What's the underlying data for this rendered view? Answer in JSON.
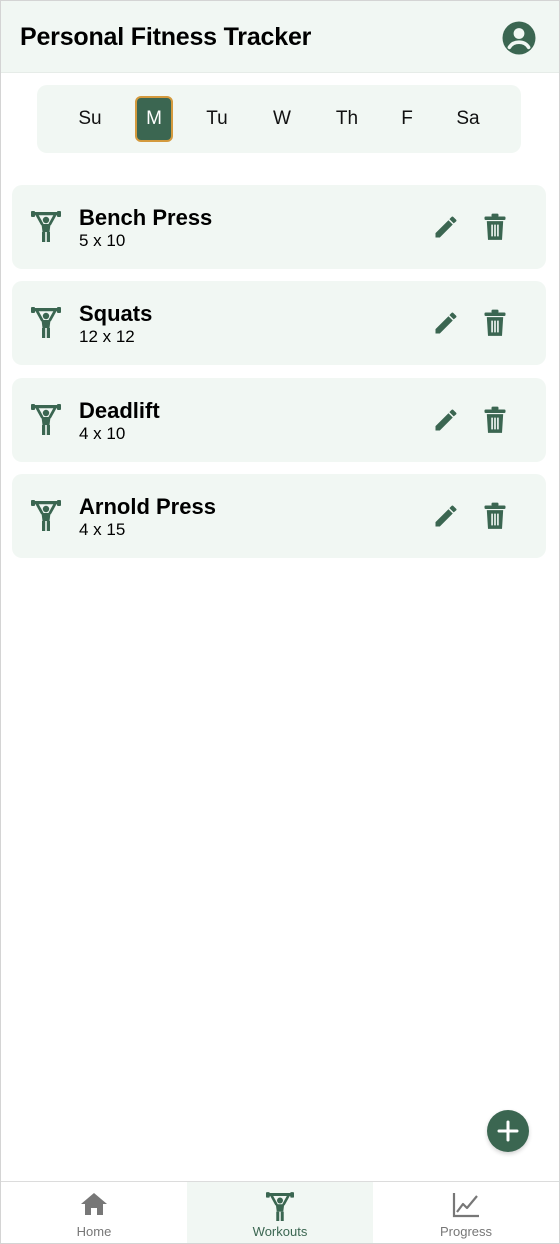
{
  "header": {
    "title": "Personal Fitness Tracker",
    "profile_icon": "account-circle-icon"
  },
  "days": [
    {
      "label": "Su",
      "selected": false
    },
    {
      "label": "M",
      "selected": true
    },
    {
      "label": "Tu",
      "selected": false
    },
    {
      "label": "W",
      "selected": false
    },
    {
      "label": "Th",
      "selected": false
    },
    {
      "label": "F",
      "selected": false
    },
    {
      "label": "Sa",
      "selected": false
    }
  ],
  "workouts": [
    {
      "name": "Bench Press",
      "sets": "5 x 10"
    },
    {
      "name": "Squats",
      "sets": "12 x 12"
    },
    {
      "name": "Deadlift",
      "sets": "4 x 10"
    },
    {
      "name": "Arnold Press",
      "sets": "4 x 15"
    }
  ],
  "fab": {
    "icon": "plus-icon"
  },
  "nav": {
    "home": "Home",
    "workouts": "Workouts",
    "progress": "Progress",
    "active": "Workouts"
  },
  "colors": {
    "accent": "#3b6651",
    "surface": "#f1f7f3",
    "selected_border": "#d49a3e",
    "inactive": "#777777"
  }
}
